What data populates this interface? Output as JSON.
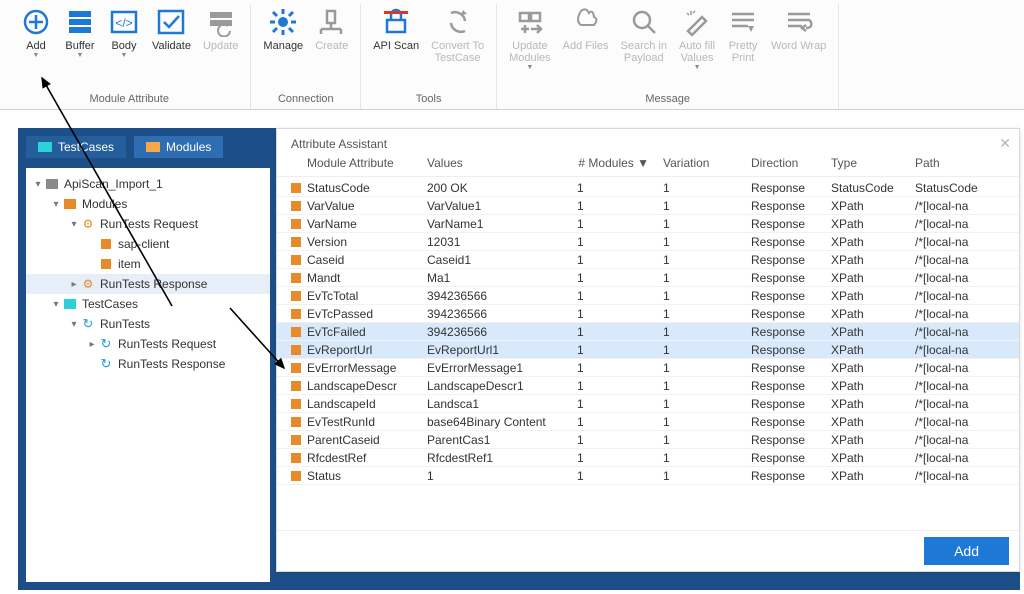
{
  "ribbon": {
    "groups": [
      {
        "title": "Module Attribute",
        "buttons": [
          {
            "id": "add",
            "label": "Add",
            "dd": true
          },
          {
            "id": "buffer",
            "label": "Buffer",
            "dd": true
          },
          {
            "id": "body",
            "label": "Body",
            "dd": true
          },
          {
            "id": "validate",
            "label": "Validate"
          },
          {
            "id": "update",
            "label": "Update",
            "disabled": true
          }
        ]
      },
      {
        "title": "Connection",
        "buttons": [
          {
            "id": "manage",
            "label": "Manage"
          },
          {
            "id": "create",
            "label": "Create",
            "disabled": true
          }
        ]
      },
      {
        "title": "Tools",
        "buttons": [
          {
            "id": "api-scan",
            "label": "API Scan"
          },
          {
            "id": "convert",
            "label": "Convert To\nTestCase",
            "disabled": true
          }
        ]
      },
      {
        "title": "Message",
        "buttons": [
          {
            "id": "upd-mod",
            "label": "Update\nModules",
            "dd": true,
            "disabled": true
          },
          {
            "id": "add-files",
            "label": "Add Files",
            "disabled": true
          },
          {
            "id": "search-payload",
            "label": "Search in\nPayload",
            "disabled": true
          },
          {
            "id": "autofill",
            "label": "Auto fill\nValues",
            "dd": true,
            "disabled": true
          },
          {
            "id": "pretty",
            "label": "Pretty\nPrint",
            "disabled": true
          },
          {
            "id": "wrap",
            "label": "Word Wrap",
            "disabled": true
          }
        ]
      }
    ]
  },
  "tabs": [
    {
      "id": "testcases",
      "label": "TestCases",
      "color": "cyan"
    },
    {
      "id": "modules",
      "label": "Modules",
      "color": "orange",
      "active": true
    }
  ],
  "tree": [
    {
      "depth": 0,
      "twisty": "▾",
      "icon": "folder-grey",
      "label": "ApiScan_Import_1"
    },
    {
      "depth": 1,
      "twisty": "▾",
      "icon": "folder-orange",
      "label": "Modules"
    },
    {
      "depth": 2,
      "twisty": "▾",
      "icon": "gear-orange",
      "label": "RunTests Request"
    },
    {
      "depth": 3,
      "twisty": "",
      "icon": "sq-orange",
      "label": "sap-client"
    },
    {
      "depth": 3,
      "twisty": "",
      "icon": "sq-orange",
      "label": "item"
    },
    {
      "depth": 2,
      "twisty": "▸",
      "icon": "gear-orange",
      "label": "RunTests Response",
      "selected": true
    },
    {
      "depth": 1,
      "twisty": "▾",
      "icon": "folder-cyan",
      "label": "TestCases"
    },
    {
      "depth": 2,
      "twisty": "▾",
      "icon": "cycle",
      "label": "RunTests"
    },
    {
      "depth": 3,
      "twisty": "▸",
      "icon": "cycle",
      "label": "RunTests Request"
    },
    {
      "depth": 3,
      "twisty": "",
      "icon": "cycle",
      "label": "RunTests Response"
    }
  ],
  "assist": {
    "title": "Attribute Assistant",
    "columns": {
      "attr": "Module Attribute",
      "values": "Values",
      "mods": "# Modules ▼",
      "variation": "Variation",
      "direction": "Direction",
      "type": "Type",
      "path": "Path"
    },
    "rows": [
      {
        "attr": "StatusCode",
        "val": "200 OK",
        "mods": "1",
        "var": "1",
        "dir": "Response",
        "type": "StatusCode",
        "path": "StatusCode"
      },
      {
        "attr": "VarValue",
        "val": "VarValue1",
        "mods": "1",
        "var": "1",
        "dir": "Response",
        "type": "XPath",
        "path": "/*[local-na"
      },
      {
        "attr": "VarName",
        "val": "VarName1",
        "mods": "1",
        "var": "1",
        "dir": "Response",
        "type": "XPath",
        "path": "/*[local-na"
      },
      {
        "attr": "Version",
        "val": "12031",
        "mods": "1",
        "var": "1",
        "dir": "Response",
        "type": "XPath",
        "path": "/*[local-na"
      },
      {
        "attr": "Caseid",
        "val": "Caseid1",
        "mods": "1",
        "var": "1",
        "dir": "Response",
        "type": "XPath",
        "path": "/*[local-na"
      },
      {
        "attr": "Mandt",
        "val": "Ma1",
        "mods": "1",
        "var": "1",
        "dir": "Response",
        "type": "XPath",
        "path": "/*[local-na"
      },
      {
        "attr": "EvTcTotal",
        "val": "394236566",
        "mods": "1",
        "var": "1",
        "dir": "Response",
        "type": "XPath",
        "path": "/*[local-na"
      },
      {
        "attr": "EvTcPassed",
        "val": "394236566",
        "mods": "1",
        "var": "1",
        "dir": "Response",
        "type": "XPath",
        "path": "/*[local-na"
      },
      {
        "attr": "EvTcFailed",
        "val": "394236566",
        "mods": "1",
        "var": "1",
        "dir": "Response",
        "type": "XPath",
        "path": "/*[local-na",
        "selected": true
      },
      {
        "attr": "EvReportUrl",
        "val": "EvReportUrl1",
        "mods": "1",
        "var": "1",
        "dir": "Response",
        "type": "XPath",
        "path": "/*[local-na",
        "selected": true
      },
      {
        "attr": "EvErrorMessage",
        "val": "EvErrorMessage1",
        "mods": "1",
        "var": "1",
        "dir": "Response",
        "type": "XPath",
        "path": "/*[local-na"
      },
      {
        "attr": "LandscapeDescr",
        "val": "LandscapeDescr1",
        "mods": "1",
        "var": "1",
        "dir": "Response",
        "type": "XPath",
        "path": "/*[local-na"
      },
      {
        "attr": "LandscapeId",
        "val": "Landsca1",
        "mods": "1",
        "var": "1",
        "dir": "Response",
        "type": "XPath",
        "path": "/*[local-na"
      },
      {
        "attr": "EvTestRunId",
        "val": "base64Binary Content",
        "mods": "1",
        "var": "1",
        "dir": "Response",
        "type": "XPath",
        "path": "/*[local-na"
      },
      {
        "attr": "ParentCaseid",
        "val": "ParentCas1",
        "mods": "1",
        "var": "1",
        "dir": "Response",
        "type": "XPath",
        "path": "/*[local-na"
      },
      {
        "attr": "RfcdestRef",
        "val": "RfcdestRef1",
        "mods": "1",
        "var": "1",
        "dir": "Response",
        "type": "XPath",
        "path": "/*[local-na"
      },
      {
        "attr": "Status",
        "val": "1",
        "mods": "1",
        "var": "1",
        "dir": "Response",
        "type": "XPath",
        "path": "/*[local-na"
      }
    ],
    "addButton": "Add"
  }
}
